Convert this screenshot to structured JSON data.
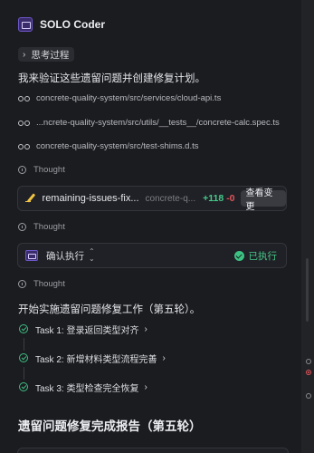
{
  "app": {
    "title": "SOLO Coder"
  },
  "thinking": {
    "label": "思考过程"
  },
  "intro": "我来验证这些遗留问题并创建修复计划。",
  "files": [
    "concrete-quality-system/src/services/cloud-api.ts",
    "...ncrete-quality-system/src/utils/__tests__/concrete-calc.spec.ts",
    "concrete-quality-system/src/test-shims.d.ts"
  ],
  "thought_label": "Thought",
  "diff": {
    "file": "remaining-issues-fix...",
    "path": "concrete-q...",
    "added": "+118",
    "removed": "-0",
    "view_button": "查看变更"
  },
  "exec": {
    "label": "确认执行",
    "status": "已执行"
  },
  "start_text": "开始实施遗留问题修复工作（第五轮）。",
  "tasks": [
    "Task 1: 登录返回类型对齐",
    "Task 2: 新增材料类型流程完善",
    "Task 3: 类型检查完全恢复"
  ],
  "report_heading": "遗留问题修复完成报告（第五轮）",
  "colors": {
    "accent_green": "#45c98a",
    "removed_red": "#e0555a",
    "brand_purple": "#6e57c9"
  },
  "icons": {
    "logo": "solo-logo-icon",
    "file": "glasses-icon",
    "thought": "info-icon",
    "diff": "pencil-icon",
    "exec": "terminal-icon",
    "done": "check-circle-icon",
    "task": "check-icon"
  }
}
